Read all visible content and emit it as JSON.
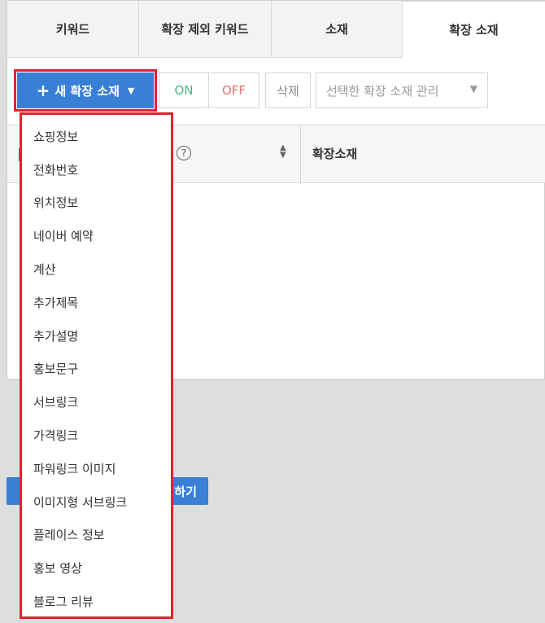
{
  "tabs": [
    {
      "label": "키워드"
    },
    {
      "label": "확장 제외 키워드"
    },
    {
      "label": "소재"
    },
    {
      "label": "확장 소재"
    }
  ],
  "toolbar": {
    "new_button_label": "새 확장 소재",
    "on_label": "ON",
    "off_label": "OFF",
    "delete_label": "삭제",
    "manage_label": "선택한 확장 소재 관리"
  },
  "table": {
    "help_symbol": "?",
    "column_title": "확장소재"
  },
  "save_button_label": "하기",
  "dropdown": {
    "items": [
      "쇼핑정보",
      "전화번호",
      "위치정보",
      "네이버 예약",
      "계산",
      "추가제목",
      "추가설명",
      "홍보문구",
      "서브링크",
      "가격링크",
      "파워링크 이미지",
      "이미지형 서브링크",
      "플레이스 정보",
      "홍보 영상",
      "블로그 리뷰"
    ]
  },
  "colors": {
    "accent": "#3a7fd6",
    "highlight": "#e1222f",
    "on": "#42b883",
    "off": "#e5716f"
  },
  "icons": [
    "plus-icon",
    "chevron-down-icon",
    "help-icon",
    "sort-icon"
  ]
}
